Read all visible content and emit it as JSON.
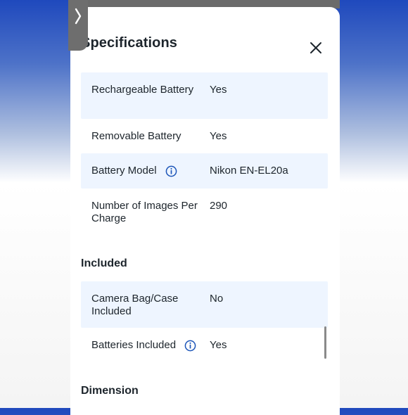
{
  "panel": {
    "title": "Specifications",
    "close_icon": "close-icon",
    "expand_icon": "chevron-right-icon"
  },
  "rows": [
    {
      "label": "Rechargeable Battery",
      "value": "Yes"
    },
    {
      "label": "Removable Battery",
      "value": "Yes"
    },
    {
      "label": "Battery Model",
      "value": "Nikon EN-EL20a",
      "info_icon": "info-icon"
    },
    {
      "label": "Number of Images Per Charge",
      "value": "290"
    }
  ],
  "sections": {
    "included": {
      "title": "Included",
      "rows": [
        {
          "label": "Camera Bag/Case Included",
          "value": "No"
        },
        {
          "label": "Batteries Included",
          "value": "Yes",
          "info_icon": "info-icon"
        }
      ]
    },
    "dimension": {
      "title": "Dimension"
    }
  },
  "colors": {
    "shaded_row": "#eef5ff",
    "info_icon": "#1c55b8",
    "text": "#1d252c"
  }
}
